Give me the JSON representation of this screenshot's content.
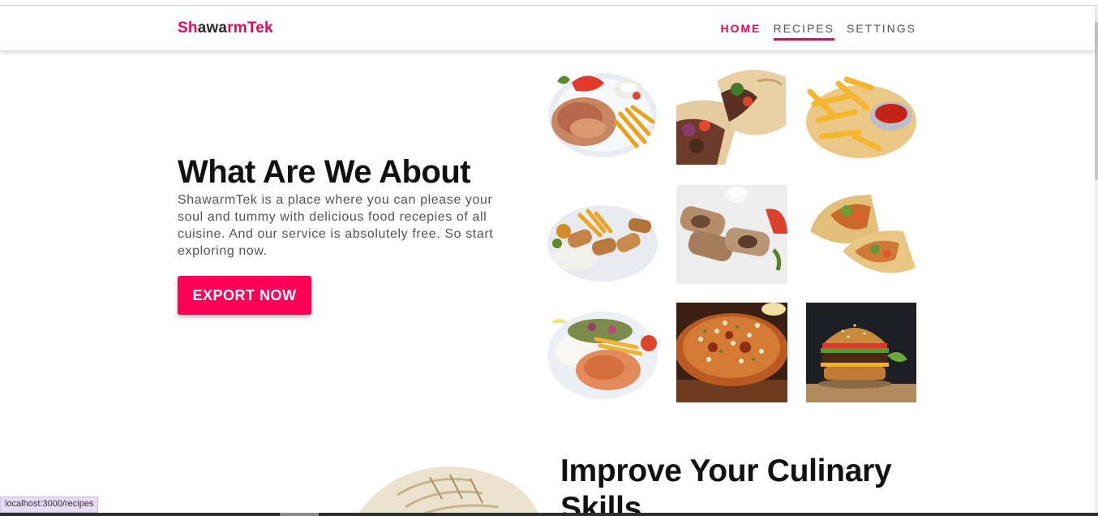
{
  "navbar": {
    "logo_part1": "Sh",
    "logo_part2": "awa",
    "logo_part3": "rmTek",
    "items": [
      {
        "label": "HOME"
      },
      {
        "label": "RECIPES"
      },
      {
        "label": "SETTINGS"
      }
    ]
  },
  "hero": {
    "title": "What Are We About",
    "description": "ShawarmTek is a place where you can please your soul and tummy with delicious food recepies of all cuisine. And our service is absolutely free. So start exploring now.",
    "button_label": "EXPORT NOW"
  },
  "section2": {
    "title": "Improve Your Culinary Skills"
  },
  "gallery": [
    {
      "name": "shawarma-plate-fries"
    },
    {
      "name": "beef-wrap-halves"
    },
    {
      "name": "crinkle-fries-ketchup"
    },
    {
      "name": "shawarma-rolls-fries-plate"
    },
    {
      "name": "sliced-wrap-dip"
    },
    {
      "name": "chicken-wrap-halves"
    },
    {
      "name": "chicken-rice-plate"
    },
    {
      "name": "biryani-plate"
    },
    {
      "name": "burger"
    }
  ],
  "status_bar": {
    "url": "localhost:3000/recipes"
  },
  "colors": {
    "accent": "#f50057",
    "button": "#ff0057"
  }
}
